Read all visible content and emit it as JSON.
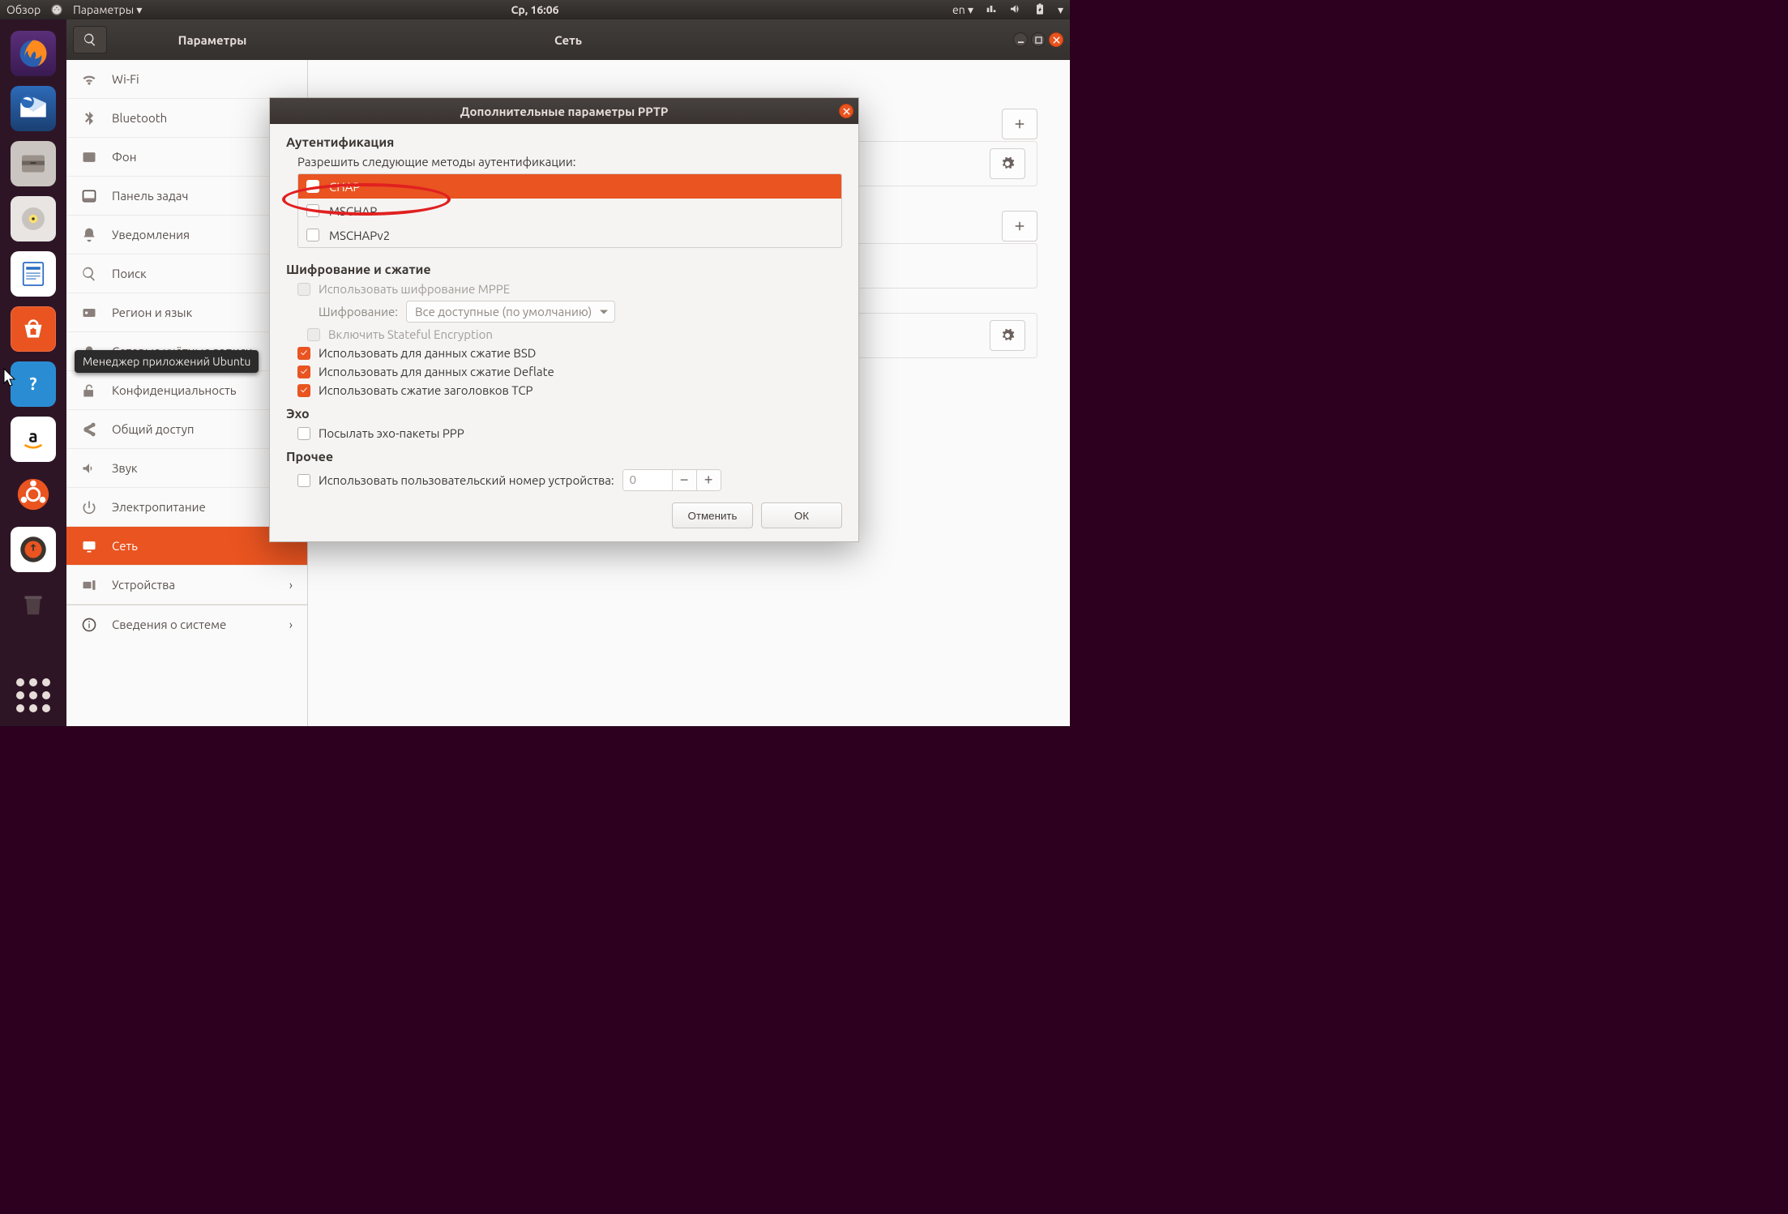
{
  "topbar": {
    "overview": "Обзор",
    "app_menu": "Параметры",
    "clock": "Ср, 16:06",
    "lang": "en"
  },
  "tooltip": "Менеджер приложений Ubuntu",
  "settings": {
    "sidebar_title": "Параметры",
    "main_title": "Сеть",
    "items": [
      {
        "label": "Wi-Fi",
        "icon": "wifi"
      },
      {
        "label": "Bluetooth",
        "icon": "bluetooth"
      },
      {
        "label": "Фон",
        "icon": "background"
      },
      {
        "label": "Панель задач",
        "icon": "dock"
      },
      {
        "label": "Уведомления",
        "icon": "bell"
      },
      {
        "label": "Поиск",
        "icon": "search"
      },
      {
        "label": "Регион и язык",
        "icon": "region"
      },
      {
        "label": "Сетевые учётные записи",
        "icon": "online-accounts"
      },
      {
        "label": "Конфиденциальность",
        "icon": "privacy"
      },
      {
        "label": "Общий доступ",
        "icon": "sharing"
      },
      {
        "label": "Звук",
        "icon": "sound"
      },
      {
        "label": "Электропитание",
        "icon": "power"
      },
      {
        "label": "Сеть",
        "icon": "network",
        "active": true
      },
      {
        "label": "Устройства",
        "icon": "devices",
        "chevron": true
      },
      {
        "label": "Сведения о системе",
        "icon": "details",
        "chevron": true
      }
    ]
  },
  "dialog": {
    "title": "Дополнительные параметры PPTP",
    "auth_h": "Аутентификация",
    "auth_sub": "Разрешить следующие методы аутентификации:",
    "auth_methods": [
      {
        "label": "CHAP",
        "checked": true,
        "selected": true
      },
      {
        "label": "MSCHAP",
        "checked": false
      },
      {
        "label": "MSCHAPv2",
        "checked": false
      }
    ],
    "enc_h": "Шифрование и сжатие",
    "mppe": "Использовать шифрование MPPE",
    "enc_label": "Шифрование:",
    "enc_combo": "Все доступные (по умолчанию)",
    "stateful": "Включить Stateful Encryption",
    "bsd": "Использовать для данных сжатие BSD",
    "deflate": "Использовать для данных сжатие Deflate",
    "tcp": "Использовать сжатие заголовков TCP",
    "echo_h": "Эхо",
    "echo_opt": "Посылать эхо-пакеты PPP",
    "misc_h": "Прочее",
    "unit_opt": "Использовать пользовательский номер устройства:",
    "unit_value": "0",
    "cancel": "Отменить",
    "ok": "ОК"
  }
}
